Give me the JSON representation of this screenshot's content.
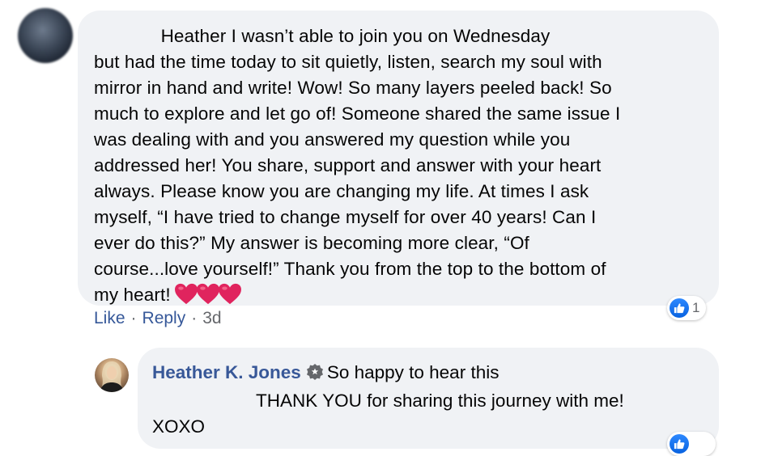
{
  "comment1": {
    "text": "             Heather I wasn’t able to join you on Wednesday\nbut had the time today to sit quietly, listen, search my soul with\nmirror in hand and write! Wow! So many layers peeled back! So\nmuch to explore and let go of! Someone shared the same issue I\nwas dealing with and you answered my question while you\naddressed her! You share, support and answer with your heart\nalways. Please know you are changing my life. At times I ask\nmyself, “I have tried to change myself for over 40 years! Can I\never do this?” My answer is becoming more clear, “Of\ncourse...love yourself!” Thank you from the top to the bottom of\nmy heart!",
    "emoji": [
      "heart-emoji",
      "heart-emoji",
      "heart-emoji"
    ],
    "reaction": {
      "icon": "like-icon",
      "count": "1"
    },
    "actions": {
      "like": "Like",
      "separator": "·",
      "reply": "Reply",
      "time": "3d"
    }
  },
  "reply1": {
    "author": "Heather K. Jones",
    "badge_icon": "verified-badge-icon",
    "line1": "So happy to hear this",
    "line2": "THANK YOU for sharing this journey with me!",
    "line3": "XOXO",
    "reaction": {
      "icon": "like-icon"
    }
  },
  "colors": {
    "bubble": "#f0f2f5",
    "link": "#385898",
    "meta": "#65676b",
    "like_blue": "#1877f2",
    "heart_red": "#e0245e"
  }
}
